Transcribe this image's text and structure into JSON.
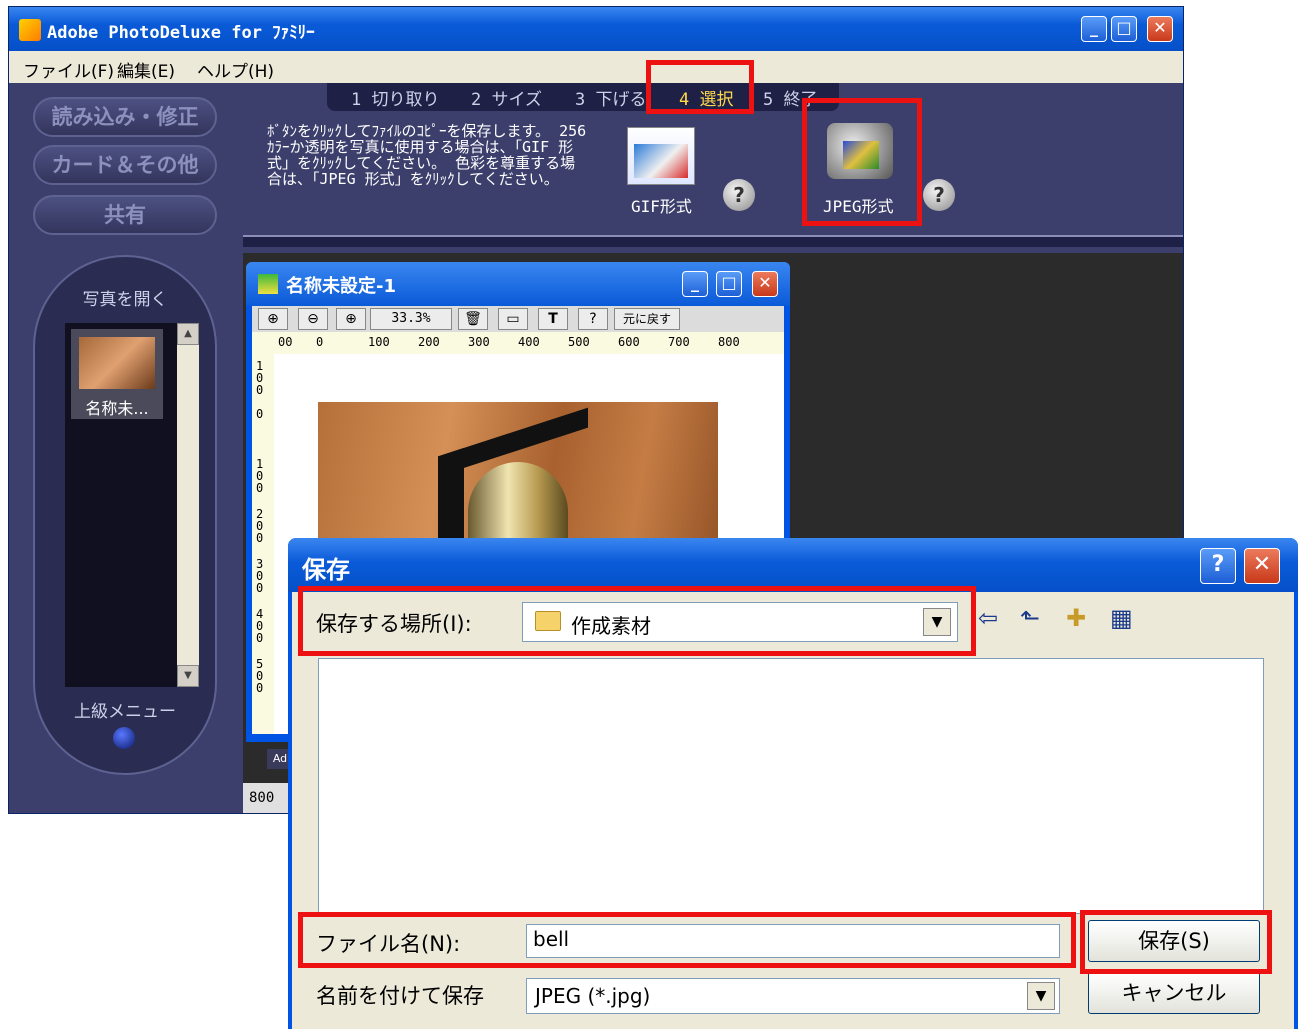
{
  "main_window": {
    "title": "Adobe PhotoDeluxe for ﾌｧﾐﾘｰ",
    "menu": [
      "ファイル(F)",
      "編集(E)",
      "ヘルプ(H)"
    ],
    "nav": [
      "読み込み・修正",
      "カード＆その他",
      "共有"
    ],
    "photo_panel": {
      "title": "写真を開く",
      "thumb_label": "名称未...",
      "advanced": "上級メニュー"
    },
    "tabs": [
      "1 切り取り",
      "2 サイズ",
      "3 下げる",
      "4 選択",
      "5 終了"
    ],
    "instructions": "ﾎﾞﾀﾝをｸﾘｯｸしてﾌｧｲﾙのｺﾋﾟｰを保存します。 256ｶﾗｰか透明を写真に使用する場合は、「GIF 形式」をｸﾘｯｸしてください。 色彩を尊重する場合は、「JPEG 形式」をｸﾘｯｸしてください。",
    "gif_label": "GIF形式",
    "jpeg_label": "JPEG形式",
    "help_glyph": "?",
    "status_left": "800",
    "status_tab": "Ad"
  },
  "doc_window": {
    "title": "名称未設定-1",
    "zoom": "33.3%",
    "revert": "元に戻す",
    "ruler_h": [
      "00",
      "0",
      "100",
      "200",
      "300",
      "400",
      "500",
      "600",
      "700",
      "800"
    ],
    "ruler_v": [
      "1\n0\n0",
      "0",
      "1\n0\n0",
      "2\n0\n0",
      "3\n0\n0",
      "4\n0\n0",
      "5\n0\n0"
    ]
  },
  "save_dialog": {
    "title": "保存",
    "location_label": "保存する場所(I):",
    "location_value": "作成素材",
    "filename_label": "ファイル名(N):",
    "filename_value": "bell",
    "type_label": "名前を付けて保存",
    "type_value": "JPEG (*.jpg)",
    "save_button": "保存(S)",
    "cancel_button": "キャンセル"
  },
  "colors": {
    "highlight": "#ee1111",
    "xp_blue": "#0054e3",
    "panel": "#3c3f6c"
  }
}
